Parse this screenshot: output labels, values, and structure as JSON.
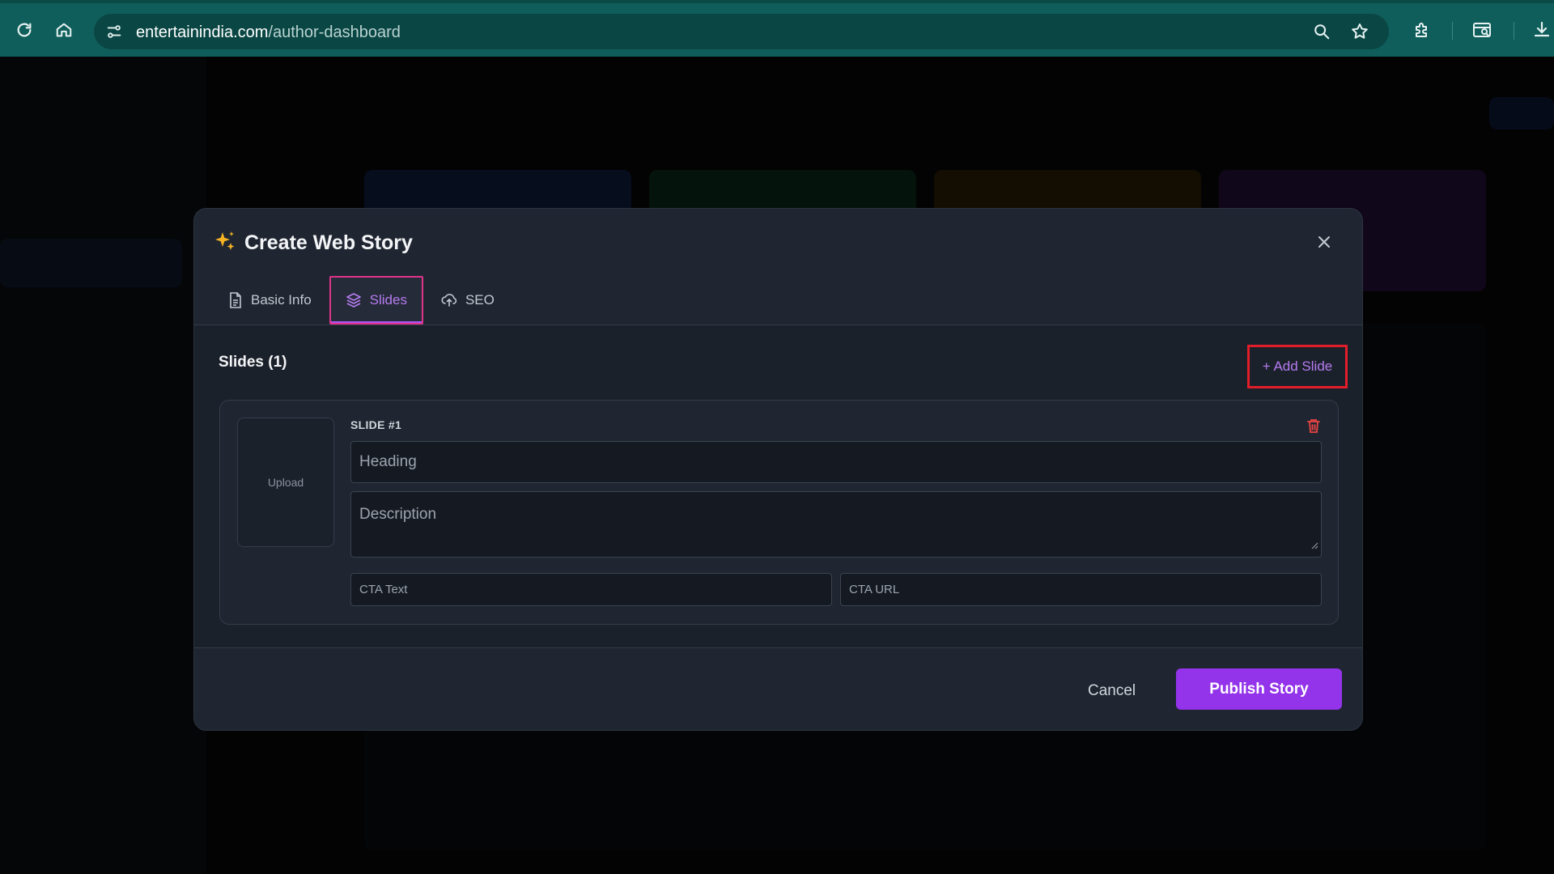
{
  "browser": {
    "url_host": "entertainindia.com",
    "url_path": "/author-dashboard",
    "icons": [
      "reload-icon",
      "home-icon",
      "site-settings-icon",
      "zoom-icon",
      "bookmark-star-icon",
      "extensions-icon",
      "tab-search-icon",
      "download-icon"
    ]
  },
  "modal": {
    "title": "Create Web Story",
    "title_icon": "sparkles-icon",
    "tabs": [
      {
        "label": "Basic Info",
        "icon": "document-icon",
        "active": false
      },
      {
        "label": "Slides",
        "icon": "layers-icon",
        "active": true
      },
      {
        "label": "SEO",
        "icon": "cloud-upload-icon",
        "active": false
      }
    ],
    "slides_heading": "Slides (1)",
    "add_slide_label": "+ Add Slide",
    "slide": {
      "label": "SLIDE #1",
      "upload_label": "Upload",
      "heading_placeholder": "Heading",
      "description_placeholder": "Description",
      "cta_text_placeholder": "CTA Text",
      "cta_url_placeholder": "CTA URL"
    },
    "footer": {
      "cancel_label": "Cancel",
      "publish_label": "Publish Story"
    }
  },
  "colors": {
    "accent": "#9333ea",
    "accent_text": "#b57cf0",
    "highlight_red": "#e11d2a",
    "tab_highlight_pink": "#e0338a",
    "delete_red": "#ef4444",
    "browser_toolbar": "#0f5e5b"
  }
}
